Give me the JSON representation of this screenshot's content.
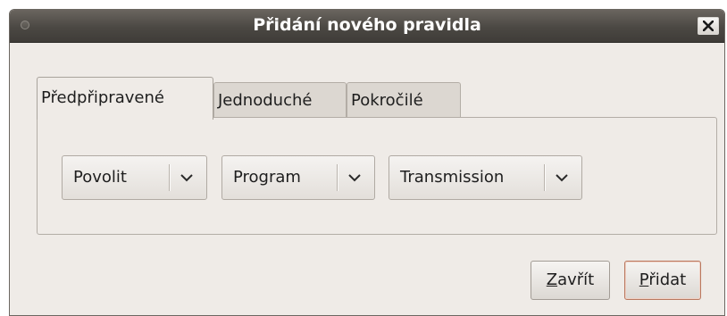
{
  "window": {
    "title": "Přidání nového pravidla"
  },
  "tabs": [
    {
      "label": "Předpřipravené",
      "active": true
    },
    {
      "label": "Jednoduché",
      "active": false
    },
    {
      "label": "Pokročilé",
      "active": false
    }
  ],
  "preconfigured": {
    "action": {
      "value": "Povolit"
    },
    "category": {
      "value": "Program"
    },
    "program": {
      "value": "Transmission"
    }
  },
  "buttons": {
    "close": {
      "mnemonic": "Z",
      "rest": "avřít"
    },
    "add": {
      "mnemonic": "P",
      "rest": "řidat"
    }
  },
  "icons": {
    "window_close": "close-icon",
    "combo_arrow": "chevron-down-icon",
    "window_menu": "window-menu-dot-icon"
  },
  "colors": {
    "titlebar": "#4b4843",
    "dialog_bg": "#efebe7",
    "default_button_border": "#b9785f"
  }
}
